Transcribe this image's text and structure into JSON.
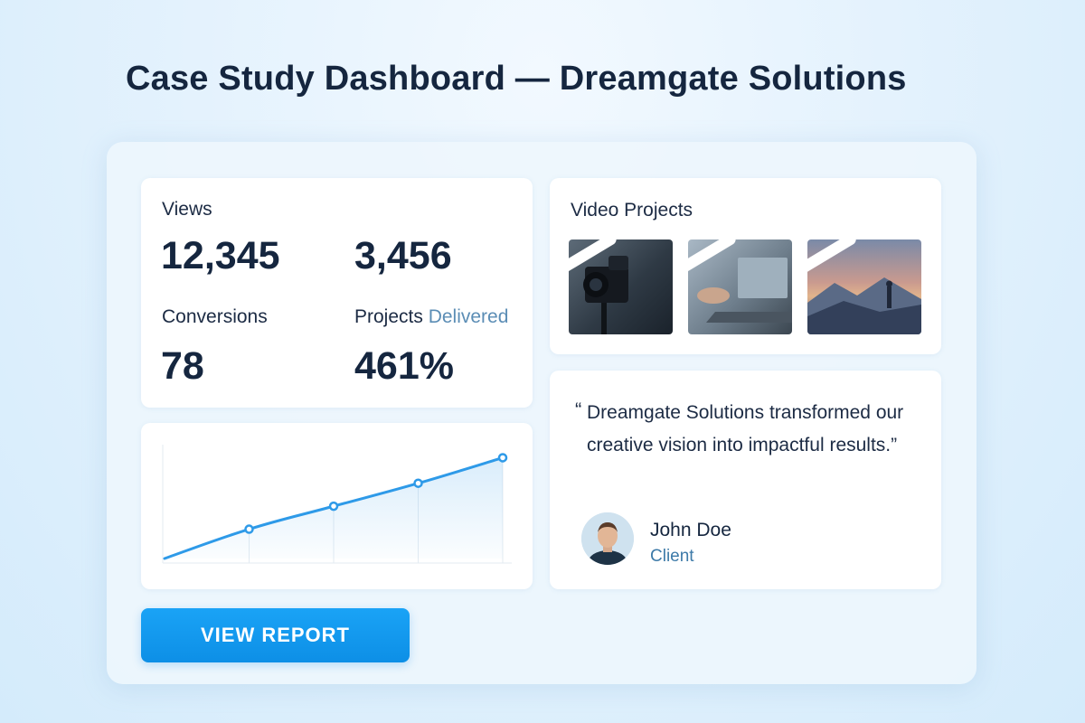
{
  "page": {
    "title": "Case Study Dashboard — Dreamgate Solutions"
  },
  "stats": {
    "views_label": "Views",
    "views_value": "12,345",
    "second_value": "3,456",
    "conversions_label": "Conversions",
    "conversions_value": "78",
    "projects_label_part1": "Projects",
    "projects_label_part2": "Delivered",
    "projects_value": "461%"
  },
  "chart_data": {
    "type": "line",
    "title": "",
    "xlabel": "",
    "ylabel": "",
    "x": [
      0,
      1,
      2,
      3,
      4
    ],
    "values": [
      0,
      2.3,
      4.1,
      5.9,
      7.9
    ],
    "marked_points": [
      1,
      2,
      3,
      4
    ],
    "ylim": [
      0,
      8.5
    ],
    "grid": false,
    "fill": true,
    "color": "#2e9ae8"
  },
  "videos": {
    "title": "Video Projects",
    "items": [
      {
        "icon": "play-icon",
        "scene": "camera"
      },
      {
        "icon": "play-icon",
        "scene": "laptop"
      },
      {
        "icon": "play-icon",
        "scene": "mountain-sunset"
      }
    ]
  },
  "testimonial": {
    "quote_mark": "“",
    "text": "Dreamgate Solutions transformed our creative vision into impactful results.”",
    "author_name": "John Doe",
    "author_role": "Client"
  },
  "actions": {
    "view_report_label": "VIEW REPORT"
  },
  "colors": {
    "accent": "#0d8fe6",
    "title": "#15263f",
    "muted_blue": "#3d7aa8",
    "background": "#e4f2fd"
  }
}
